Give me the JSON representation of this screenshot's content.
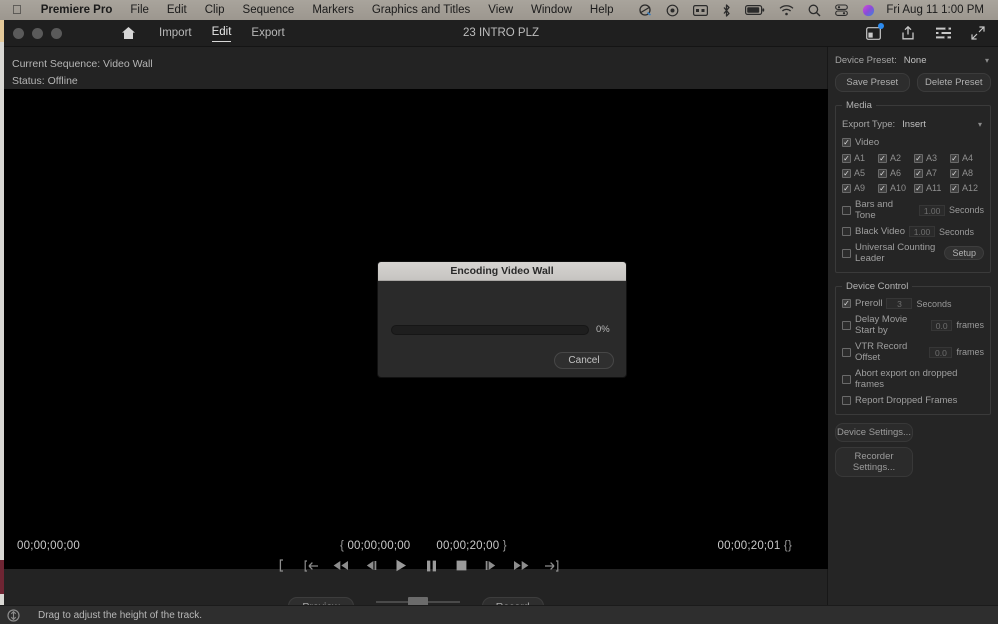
{
  "menubar": {
    "apple_icon": "apple-icon",
    "items": [
      {
        "label": "Premiere Pro",
        "bold": true
      },
      {
        "label": "File"
      },
      {
        "label": "Edit"
      },
      {
        "label": "Clip"
      },
      {
        "label": "Sequence"
      },
      {
        "label": "Markers"
      },
      {
        "label": "Graphics and Titles"
      },
      {
        "label": "View"
      },
      {
        "label": "Window"
      },
      {
        "label": "Help"
      }
    ],
    "status_icons": [
      "screenshare-icon",
      "timemachine-icon",
      "battery-meter-icon",
      "bluetooth-icon",
      "battery-icon",
      "wifi-icon",
      "spotlight-search-icon",
      "control-center-icon",
      "siri-icon"
    ],
    "clock": "Fri Aug 11  1:00 PM"
  },
  "titlebar": {
    "window_title": "23 INTRO PLZ",
    "home_icon": "home-icon",
    "tabs": [
      {
        "label": "Import",
        "active": false
      },
      {
        "label": "Edit",
        "active": true
      },
      {
        "label": "Export",
        "active": false
      }
    ],
    "right_icons": [
      "workspace-notification-icon",
      "share-export-icon",
      "quick-settings-icon",
      "fullscreen-icon"
    ]
  },
  "monitor": {
    "current_sequence_label": "Current Sequence: Video Wall",
    "status_label": "Status: Offline",
    "timecode": {
      "playhead": "00;00;00;00",
      "in_point": "00;00;00;00",
      "out_point": "00;00;20;00",
      "duration": "00;00;20;01"
    },
    "transport_icons": [
      "set-in-point-icon",
      "go-to-in-point-icon",
      "rewind-icon",
      "step-back-icon",
      "play-icon",
      "pause-icon",
      "stop-icon",
      "step-forward-icon",
      "fast-forward-icon",
      "go-to-out-point-icon"
    ],
    "preview_label": "Preview",
    "record_label": "Record"
  },
  "side": {
    "device_preset": {
      "label": "Device Preset:",
      "value": "None"
    },
    "save_preset_label": "Save Preset",
    "delete_preset_label": "Delete Preset",
    "media": {
      "legend": "Media",
      "export_type": {
        "label": "Export Type:",
        "value": "Insert"
      },
      "video": {
        "label": "Video",
        "checked": true
      },
      "audio_channels": [
        {
          "label": "A1",
          "checked": true
        },
        {
          "label": "A2",
          "checked": true
        },
        {
          "label": "A3",
          "checked": true
        },
        {
          "label": "A4",
          "checked": true
        },
        {
          "label": "A5",
          "checked": true
        },
        {
          "label": "A6",
          "checked": true
        },
        {
          "label": "A7",
          "checked": true
        },
        {
          "label": "A8",
          "checked": true
        },
        {
          "label": "A9",
          "checked": true
        },
        {
          "label": "A10",
          "checked": true
        },
        {
          "label": "A11",
          "checked": true
        },
        {
          "label": "A12",
          "checked": true
        }
      ],
      "bars_and_tone": {
        "label": "Bars and Tone",
        "checked": false,
        "value": "1.00",
        "unit": "Seconds"
      },
      "black_video": {
        "label": "Black Video",
        "checked": false,
        "value": "1.00",
        "unit": "Seconds"
      },
      "counting_leader": {
        "label": "Universal Counting Leader",
        "checked": false,
        "button": "Setup"
      }
    },
    "device_control": {
      "legend": "Device Control",
      "preroll": {
        "label": "Preroll",
        "checked": true,
        "value": "3",
        "unit": "Seconds"
      },
      "delay_movie_start": {
        "label": "Delay Movie Start by",
        "checked": false,
        "value": "0.0",
        "unit": "frames"
      },
      "vtr_record_offset": {
        "label": "VTR Record Offset",
        "checked": false,
        "value": "0.0",
        "unit": "frames"
      },
      "abort_export": {
        "label": "Abort export on dropped frames",
        "checked": false
      },
      "report_dropped": {
        "label": "Report Dropped Frames",
        "checked": false
      }
    },
    "device_settings_label": "Device Settings...",
    "recorder_settings_label": "Recorder Settings..."
  },
  "modal": {
    "title": "Encoding Video Wall",
    "progress_percent": "0%",
    "progress_value": 0,
    "cancel_label": "Cancel"
  },
  "statusbar": {
    "icon": "track-height-icon",
    "message": "Drag to adjust the height of the track."
  },
  "colors": {
    "accent_blue": "#2d8cf0",
    "menubar": "#a9a49c",
    "panel_bg": "#252525",
    "window_bg": "#232323"
  }
}
